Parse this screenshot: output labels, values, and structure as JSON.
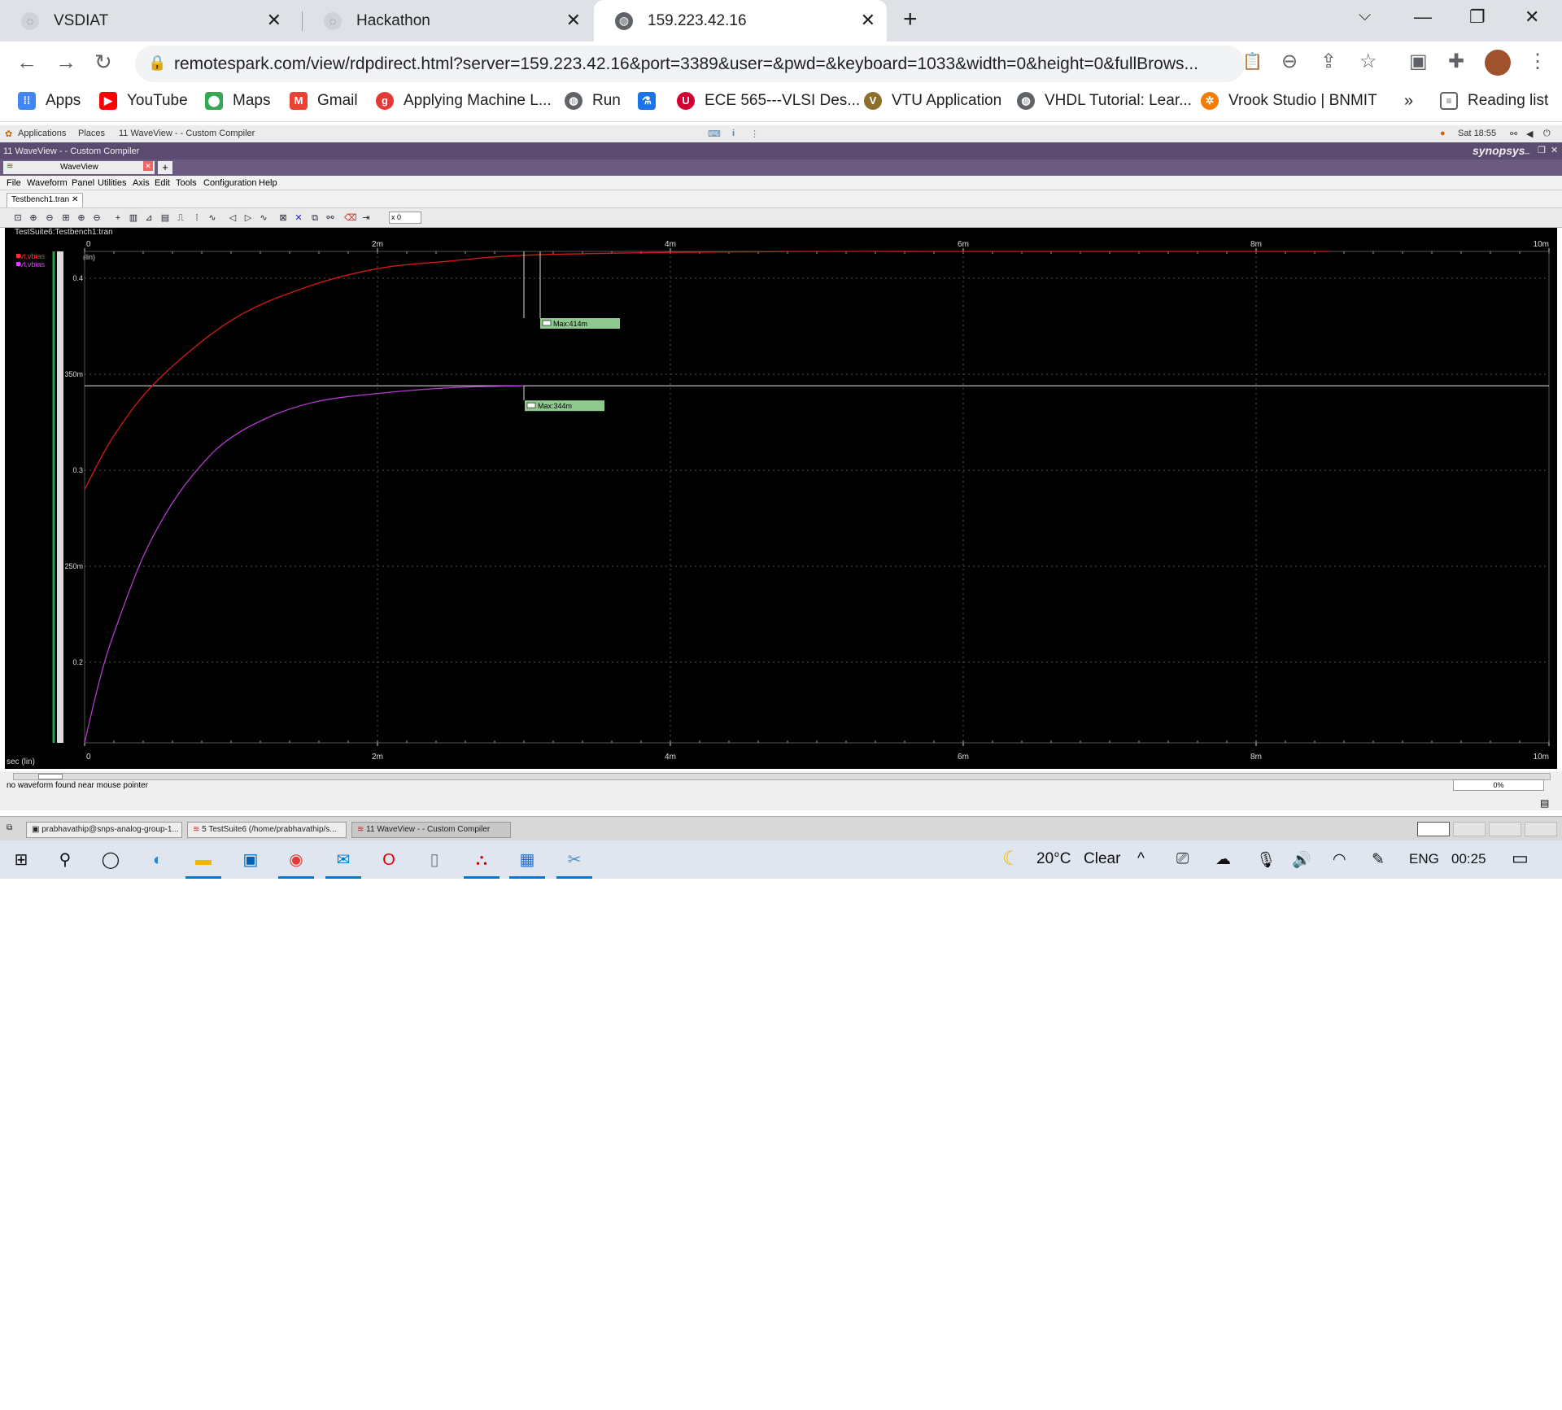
{
  "browser": {
    "tabs": [
      {
        "title": "VSDIAT",
        "icon": "globe-icon"
      },
      {
        "title": "Hackathon",
        "icon": "globe-icon"
      },
      {
        "title": "159.223.42.16",
        "icon": "globe-icon"
      }
    ],
    "new_tab_symbol": "+",
    "url": "remotespark.com/view/rdpdirect.html?server=159.223.42.16&port=3389&user=&pwd=&keyboard=1033&width=0&height=0&fullBrows...",
    "bookmarks": [
      {
        "label": "Apps",
        "icon": "apps-grid-icon",
        "color": "#4285f4"
      },
      {
        "label": "YouTube",
        "icon": "youtube-icon",
        "color": "#ff0000"
      },
      {
        "label": "Maps",
        "icon": "maps-pin-icon",
        "color": "#34a853"
      },
      {
        "label": "Gmail",
        "icon": "gmail-icon",
        "color": "#ea4335"
      },
      {
        "label": "Applying Machine L...",
        "icon": "g-icon",
        "color": "#e53935"
      },
      {
        "label": "Run",
        "icon": "globe-icon",
        "color": "#5f6368"
      },
      {
        "label": "",
        "icon": "microscope-icon",
        "color": "#1a73e8"
      },
      {
        "label": "ECE 565---VLSI Des...",
        "icon": "uic-icon",
        "color": "#d50032"
      },
      {
        "label": "VTU Application",
        "icon": "vtu-icon",
        "color": "#8d6e2a"
      },
      {
        "label": "VHDL Tutorial: Lear...",
        "icon": "globe-icon",
        "color": "#5f6368"
      },
      {
        "label": "Vrook Studio | BNMIT",
        "icon": "vrook-icon",
        "color": "#f57c00"
      }
    ],
    "more_symbol": "»",
    "reading_list": "Reading list"
  },
  "remote": {
    "gnome_bar": {
      "applications": "Applications",
      "places": "Places",
      "window_item": "11 WaveView -  - Custom Compiler",
      "clock": "Sat 18:55"
    },
    "cc_title": "11 WaveView -  - Custom Compiler",
    "brand": "synopsys",
    "wv_tab": "WaveView",
    "menu": [
      "File",
      "Waveform",
      "Panel",
      "Utilities",
      "Axis",
      "Edit",
      "Tools",
      "Configuration",
      "Help"
    ],
    "file_tab": "Testbench1.tran",
    "zoom_field": "x 0",
    "panel_title": "TestSuite6:Testbench1:tran",
    "signals": [
      {
        "name": "/vt,vbias",
        "color": "#ff3030"
      },
      {
        "name": "/vt,vbias",
        "color": "#e040fb"
      }
    ],
    "axis_scale_label": "(lin)",
    "x_axis_label": "sec (lin)",
    "status_message": "no waveform found near mouse pointer",
    "progress": "0%",
    "taskbar": [
      "prabhavathip@snps-analog-group-1...",
      "5 TestSuite6 (/home/prabhavathip/s...",
      "11 WaveView -  - Custom Compiler"
    ]
  },
  "chart_data": {
    "type": "line",
    "title": "TestSuite6:Testbench1:tran",
    "xlabel": "sec (lin)",
    "ylabel": "(lin)",
    "xlim": [
      0,
      0.01
    ],
    "ylim": [
      0.158,
      0.414
    ],
    "x_ticks": [
      "0",
      "2m",
      "4m",
      "6m",
      "8m",
      "10m"
    ],
    "y_ticks": [
      {
        "label": "0.4",
        "value": 0.4
      },
      {
        "label": "350m",
        "value": 0.35
      },
      {
        "label": "0.3",
        "value": 0.3
      },
      {
        "label": "250m",
        "value": 0.25
      },
      {
        "label": "0.2",
        "value": 0.2
      }
    ],
    "grid": true,
    "series": [
      {
        "name": "/vt,vbias",
        "color": "#d21a1a",
        "x": [
          0,
          0.0002,
          0.0005,
          0.001,
          0.0015,
          0.002,
          0.0025,
          0.003,
          0.004,
          0.005,
          0.006,
          0.007,
          0.008,
          0.0085
        ],
        "y": [
          0.29,
          0.318,
          0.347,
          0.378,
          0.395,
          0.405,
          0.409,
          0.412,
          0.4135,
          0.414,
          0.414,
          0.414,
          0.414,
          0.414
        ]
      },
      {
        "name": "/vt,vbias",
        "color": "#b43ad0",
        "x": [
          0,
          0.0001,
          0.0002,
          0.0004,
          0.0006,
          0.0008,
          0.001,
          0.0013,
          0.0016,
          0.002,
          0.0025,
          0.003
        ],
        "y": [
          0.158,
          0.19,
          0.215,
          0.255,
          0.283,
          0.303,
          0.317,
          0.329,
          0.336,
          0.34,
          0.343,
          0.344
        ]
      }
    ],
    "markers": [
      {
        "label": "Max:414m",
        "x": 0.003,
        "y": 0.414
      },
      {
        "label": "Max:344m",
        "x": 0.003,
        "y": 0.344
      }
    ],
    "cursor_line_y": 0.344
  },
  "windows": {
    "weather_temp": "20°C",
    "weather_cond": "Clear",
    "language": "ENG",
    "time": "00:25"
  }
}
